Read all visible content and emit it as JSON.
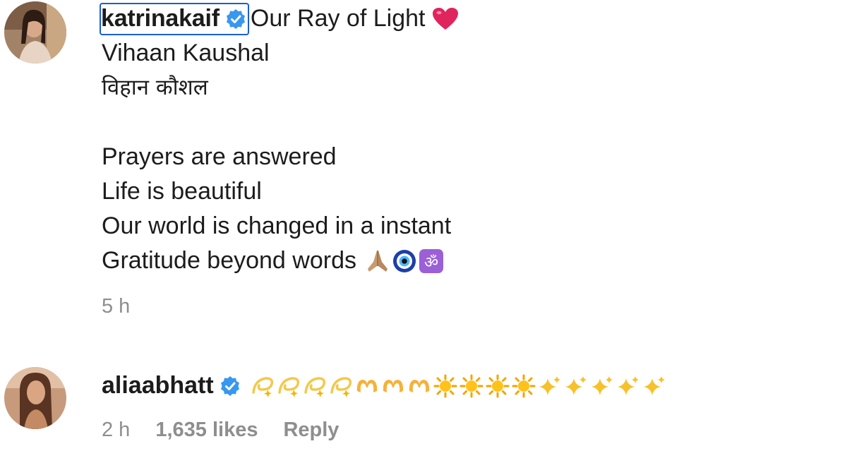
{
  "comments": [
    {
      "username": "katrinakaif",
      "verified": true,
      "first_line": "Our Ray of Light",
      "first_line_emoji": "heart-emoji",
      "lines": [
        "Vihaan Kaushal",
        "विहान कौशल",
        "",
        "Prayers are answered",
        "Life is beautiful",
        "Our world is changed in a instant",
        "Gratitude beyond words"
      ],
      "last_line_emojis": [
        "folded-hands-emoji",
        "nazar-amulet-emoji",
        "om-emoji"
      ],
      "time": "5 h"
    },
    {
      "username": "aliaabhatt",
      "verified": true,
      "emojis": [
        "dizzy-emoji",
        "dizzy-emoji",
        "dizzy-emoji",
        "dizzy-emoji",
        "heart-hands-emoji",
        "heart-hands-emoji",
        "heart-hands-emoji",
        "sun-emoji",
        "sun-emoji",
        "sun-emoji",
        "sun-emoji",
        "sparkles-emoji",
        "sparkles-emoji",
        "sparkles-emoji",
        "sparkles-emoji",
        "sparkles-emoji"
      ],
      "time": "2 h",
      "likes": "1,635 likes",
      "reply_label": "Reply"
    }
  ],
  "colors": {
    "verified_badge": "#3897f0",
    "highlight_border": "#1a5fcf",
    "meta_text": "#8e8e8e",
    "heart": "#e0245e"
  }
}
